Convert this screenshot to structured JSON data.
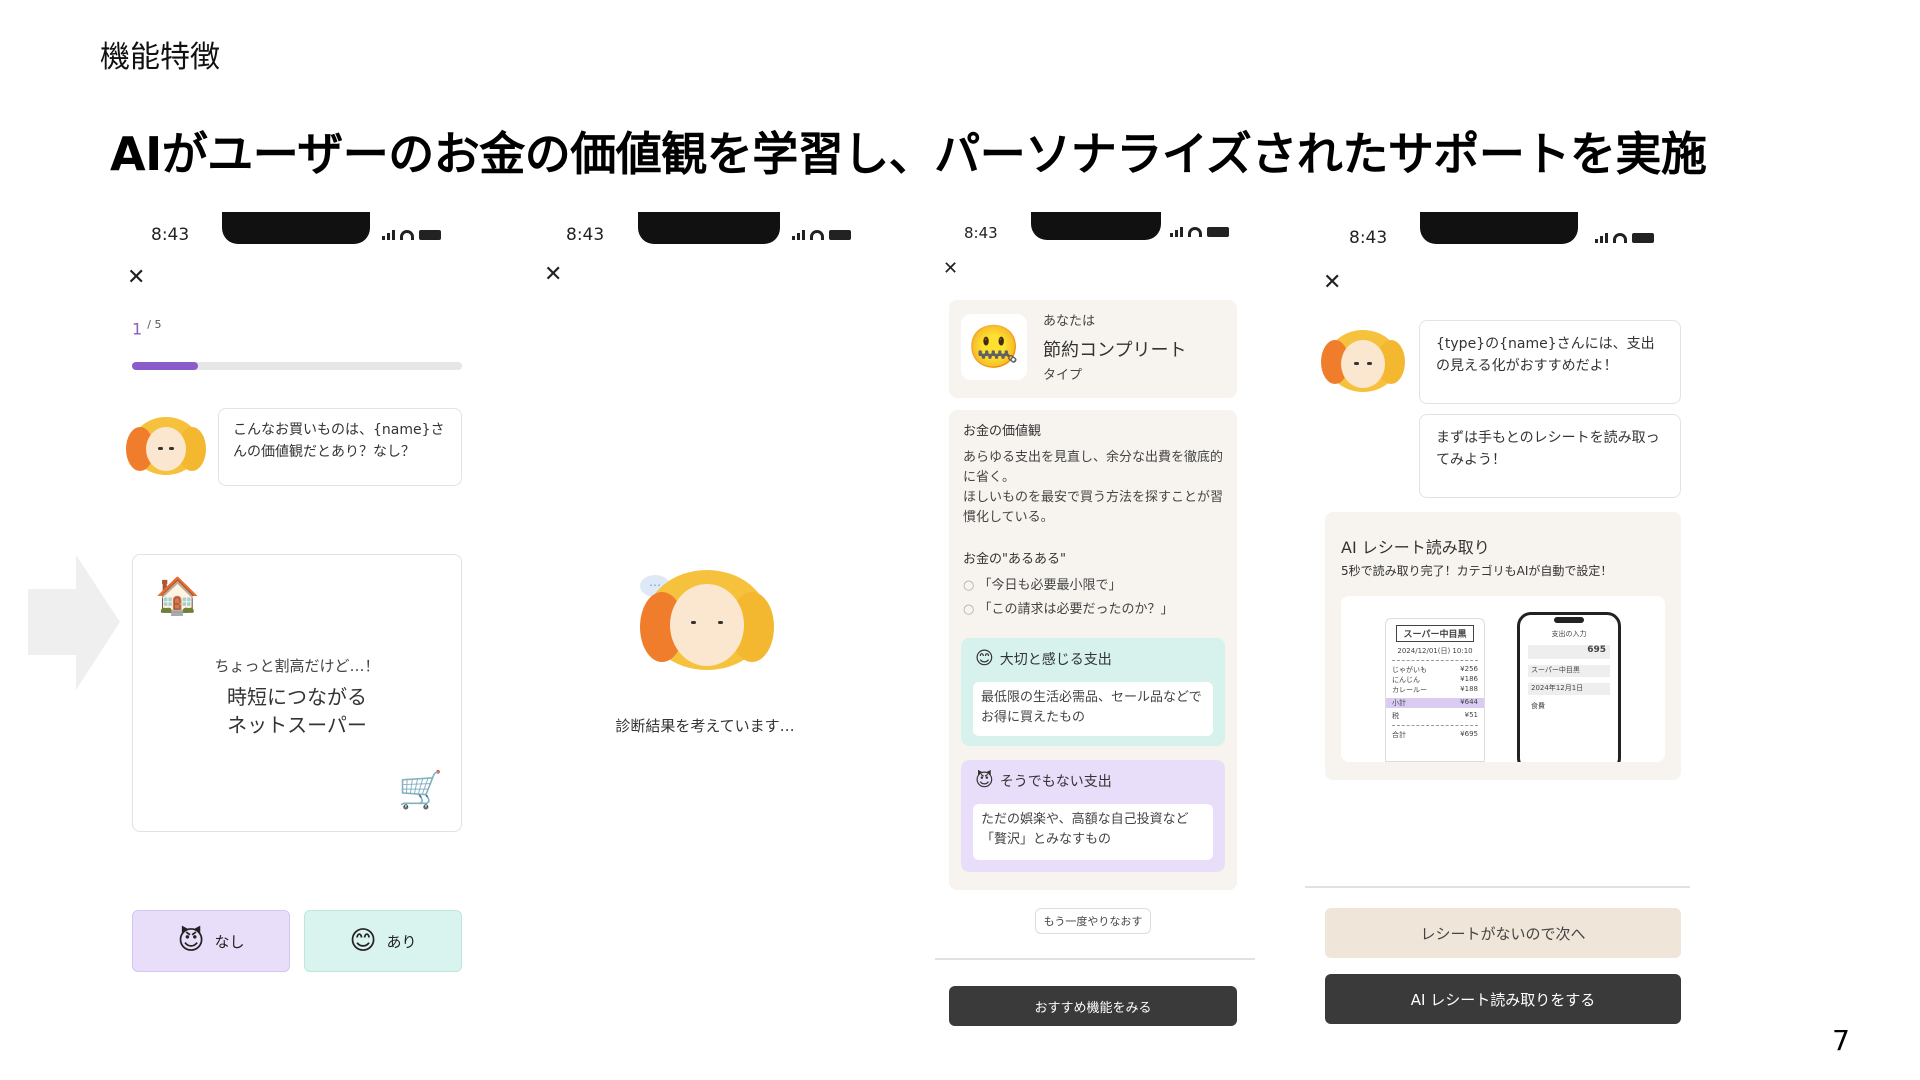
{
  "slide": {
    "label": "機能特徴",
    "headline": "AIがユーザーのお金の価値観を学習し、パーソナライズされたサポートを実施",
    "page": "7"
  },
  "status": {
    "time": "8:43"
  },
  "close_glyph": "✕",
  "screen1": {
    "progress": {
      "current": "1",
      "total": "/ 5",
      "fraction": 0.2
    },
    "bubble": "こんなお買いものは、{name}さんの価値観だとあり？なし？",
    "card_icon": "🏠",
    "card_sub": "ちょっと割高だけど…！",
    "card_title_1": "時短につながる",
    "card_title_2": "ネットスーパー",
    "cart_icon": "🛒",
    "no_icon": "😈",
    "no_label": "なし",
    "yes_icon": "😊",
    "yes_label": "あり",
    "colors": {
      "no_bg": "#e9defa",
      "yes_bg": "#d9f3ee",
      "accent": "#8a5cc9"
    }
  },
  "screen2": {
    "loading_text": "診断結果を考えています…"
  },
  "screen3": {
    "type_icon": "🤐",
    "type_pre": "あなたは",
    "type_name": "節約コンプリート",
    "type_post": "タイプ",
    "values_title": "お金の価値観",
    "values_body_1": "あらゆる支出を見直し、余分な出費を徹底的に省く。",
    "values_body_2": "ほしいものを最安で買う方法を探すことが習慣化している。",
    "aruaru_title": "お金の\"あるある\"",
    "aruaru_1": "「今日も必要最小限で」",
    "aruaru_2": "「この請求は必要だったのか？」",
    "important_icon": "😊",
    "important_title": "大切と感じる支出",
    "important_body": "最低限の生活必需品、セール品などでお得に買えたもの",
    "notimportant_icon": "😈",
    "notimportant_title": "そうでもない支出",
    "notimportant_body": "ただの娯楽や、高額な自己投資など「贅沢」とみなすもの",
    "retry": "もう一度やりなおす",
    "cta": "おすすめ機能をみる"
  },
  "screen4": {
    "bubble_1": "{type}の{name}さんには、支出の見える化がおすすめだよ！",
    "bubble_2": "まずは手もとのレシートを読み取ってみよう！",
    "feature_title": "AI レシート読み取り",
    "feature_desc": "5秒で読み取り完了！カテゴリもAIが自動で設定！",
    "receipt": {
      "store": "スーパー中目黒",
      "date": "2024/12/01(日) 10:10",
      "items": [
        {
          "name": "じゃがいも",
          "price": "¥256"
        },
        {
          "name": "にんじん",
          "price": "¥186"
        },
        {
          "name": "カレールー",
          "price": "¥188"
        }
      ],
      "subtotal_label": "小計",
      "subtotal": "¥644",
      "tax_label": "税",
      "tax": "¥51",
      "total_label": "合計",
      "total": "¥695"
    },
    "phone": {
      "title": "支出の入力",
      "amount": "695",
      "store": "スーパー中目黒",
      "date": "2024年12月1日",
      "category": "食費"
    },
    "skip": "レシートがないので次へ",
    "cta": "AI レシート読み取りをする"
  }
}
